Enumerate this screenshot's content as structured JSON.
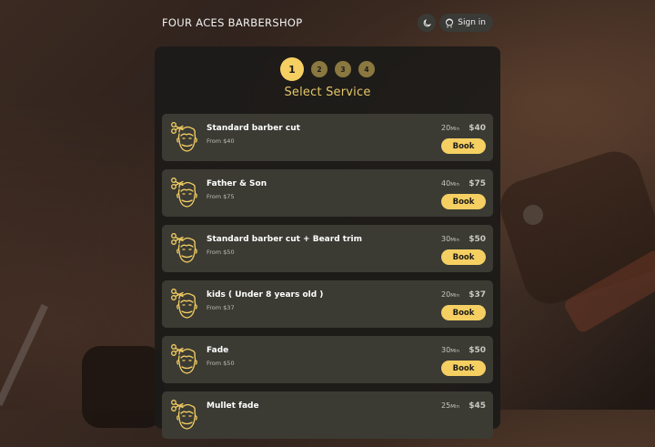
{
  "header": {
    "brand": "FOUR ACES BARBERSHOP",
    "signin_label": "Sign in",
    "theme_icon": "moon-icon",
    "user_icon": "user-icon"
  },
  "steps": [
    "1",
    "2",
    "3",
    "4"
  ],
  "active_step": 1,
  "title": "Select Service",
  "services": [
    {
      "name": "Standard barber cut",
      "from": "From $40",
      "duration": "20",
      "unit": "Min",
      "price": "$40",
      "book": "Book"
    },
    {
      "name": "Father & Son",
      "from": "From $75",
      "duration": "40",
      "unit": "Min",
      "price": "$75",
      "book": "Book"
    },
    {
      "name": "Standard barber cut + Beard trim",
      "from": "From $50",
      "duration": "30",
      "unit": "Min",
      "price": "$50",
      "book": "Book"
    },
    {
      "name": "kids ( Under 8 years old )",
      "from": "From $37",
      "duration": "20",
      "unit": "Min",
      "price": "$37",
      "book": "Book"
    },
    {
      "name": "Fade",
      "from": "From $50",
      "duration": "30",
      "unit": "Min",
      "price": "$50",
      "book": "Book"
    },
    {
      "name": "Mullet fade",
      "from": "",
      "duration": "25",
      "unit": "Min",
      "price": "$45",
      "book": ""
    }
  ],
  "colors": {
    "accent": "#f5cf62",
    "panel": "#1c1b19",
    "card": "#3b3b34"
  }
}
